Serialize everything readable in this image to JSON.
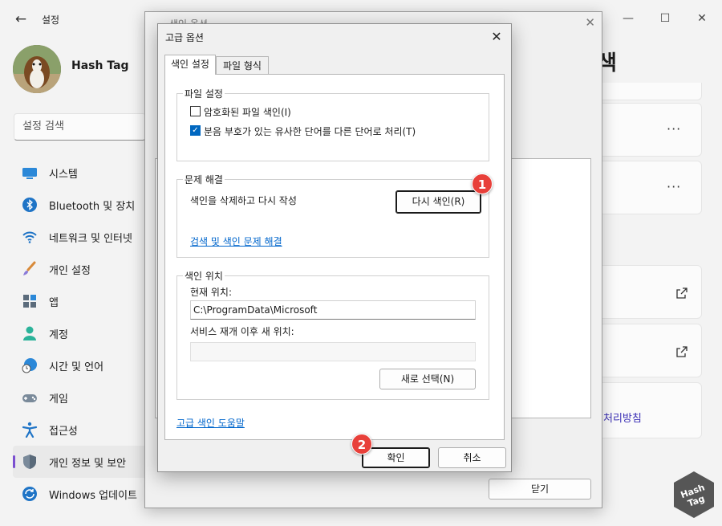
{
  "settings": {
    "app_title": "설정",
    "user_name": "Hash Tag",
    "search_placeholder": "설정 검색",
    "page_heading": "색",
    "privacy_link": "처리방침",
    "nav_items": [
      {
        "label": "시스템",
        "icon": "system-icon"
      },
      {
        "label": "Bluetooth 및 장치",
        "icon": "bluetooth-icon"
      },
      {
        "label": "네트워크 및 인터넷",
        "icon": "wifi-icon"
      },
      {
        "label": "개인 설정",
        "icon": "brush-icon"
      },
      {
        "label": "앱",
        "icon": "apps-icon"
      },
      {
        "label": "계정",
        "icon": "account-icon"
      },
      {
        "label": "시간 및 언어",
        "icon": "time-language-icon"
      },
      {
        "label": "게임",
        "icon": "gamepad-icon"
      },
      {
        "label": "접근성",
        "icon": "accessibility-icon"
      },
      {
        "label": "개인 정보 및 보안",
        "icon": "shield-icon"
      },
      {
        "label": "Windows 업데이트",
        "icon": "update-icon"
      }
    ],
    "active_index": 9
  },
  "indexing_window": {
    "title": "색인 옵션",
    "close_label": "닫기"
  },
  "dialog": {
    "title": "고급 옵션",
    "tabs": [
      "색인 설정",
      "파일 형식"
    ],
    "file_settings": {
      "legend": "파일 설정",
      "encrypt_label": "암호화된 파일 색인(I)",
      "encrypt_checked": false,
      "diacritics_label": "분음 부호가 있는 유사한 단어를 다른 단어로 처리(T)",
      "diacritics_checked": true
    },
    "troubleshoot": {
      "legend": "문제 해결",
      "rebuild_text": "색인을 삭제하고 다시 작성",
      "rebuild_button": "다시 색인(R)",
      "link": "검색 및 색인 문제 해결"
    },
    "index_location": {
      "legend": "색인 위치",
      "current_label": "현재 위치:",
      "current_value": "C:\\ProgramData\\Microsoft",
      "new_label": "서비스 재개 이후 새 위치:",
      "new_value": "",
      "select_button": "새로 선택(N)"
    },
    "help_link": "고급 색인 도움말",
    "ok_button": "확인",
    "cancel_button": "취소"
  },
  "annotations": {
    "step1": "1",
    "step2": "2"
  },
  "watermark_text": "Hash Tag"
}
